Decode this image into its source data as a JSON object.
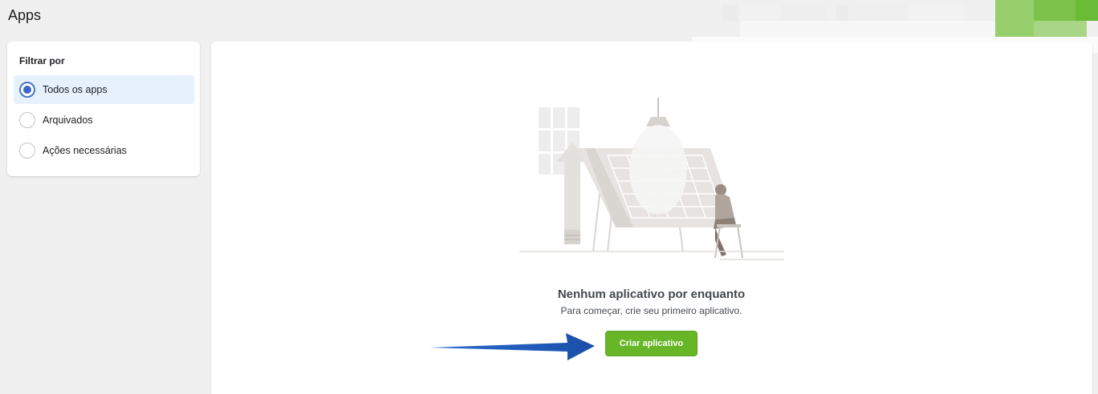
{
  "page": {
    "title": "Apps"
  },
  "filter": {
    "title": "Filtrar por",
    "options": [
      {
        "label": "Todos os apps",
        "selected": true
      },
      {
        "label": "Arquivados",
        "selected": false
      },
      {
        "label": "Ações necessárias",
        "selected": false
      }
    ]
  },
  "empty_state": {
    "title": "Nenhum aplicativo por enquanto",
    "subtitle": "Para começar, crie seu primeiro aplicativo.",
    "illustration": "empty-state-illustration",
    "create_button_label": "Criar aplicativo"
  },
  "annotation": {
    "icon": "blue-arrow-icon",
    "color": "#1f5fbf"
  },
  "colors": {
    "accent_blue": "#3b68c7",
    "primary_green": "#67b627",
    "selected_bg": "#e7f0fd"
  }
}
